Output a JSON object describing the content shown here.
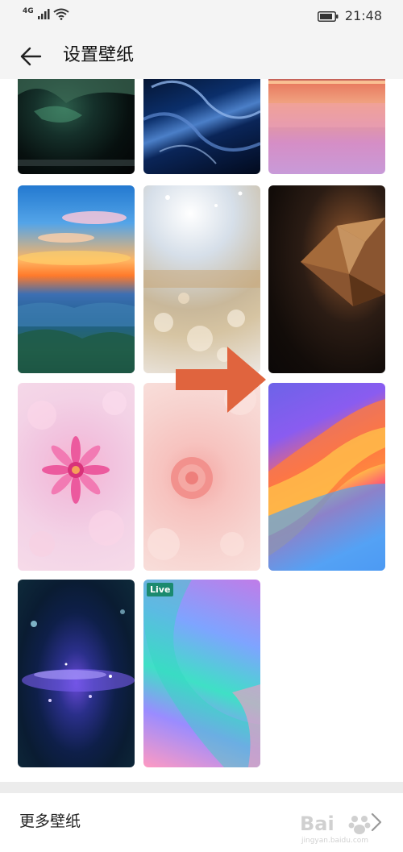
{
  "status_bar": {
    "network": "4G",
    "time": "21:48"
  },
  "header": {
    "title": "设置壁纸"
  },
  "wallpapers": [
    {
      "name": "cave",
      "live": false
    },
    {
      "name": "ocean-wave",
      "live": false
    },
    {
      "name": "pink-sunset",
      "live": false
    },
    {
      "name": "sky-clouds",
      "live": false
    },
    {
      "name": "glitter-bokeh",
      "live": false
    },
    {
      "name": "brown-diamond",
      "live": false
    },
    {
      "name": "pink-flower",
      "live": false
    },
    {
      "name": "pink-rose",
      "live": false
    },
    {
      "name": "color-flow",
      "live": false
    },
    {
      "name": "space-particles",
      "live": false
    },
    {
      "name": "gradient-live",
      "live": true,
      "badge": "Live"
    }
  ],
  "more": {
    "label": "更多壁纸"
  },
  "watermark": {
    "text": "Bai",
    "sub": "jingyan.baidu.com"
  },
  "colors": {
    "arrow": "#e0643e",
    "live_badge": "#1b8a6f"
  }
}
